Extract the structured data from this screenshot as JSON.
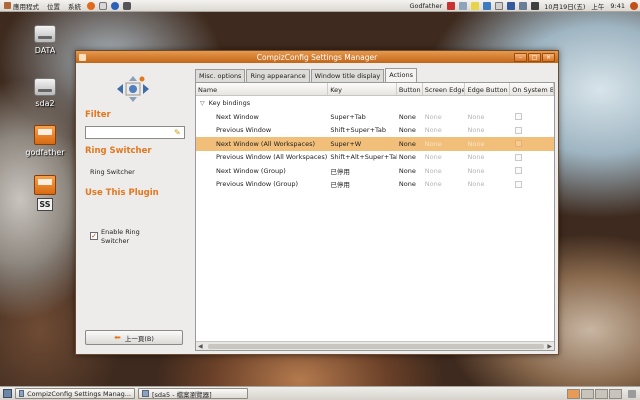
{
  "top_panel": {
    "menus": [
      "應用程式",
      "位置",
      "系統"
    ],
    "user": "Godfather",
    "date": "10月19日(五)",
    "ampm": "上午",
    "time": "9:41"
  },
  "desktop_icons": [
    {
      "label": "DATA",
      "icon": "drive-icon"
    },
    {
      "label": "sda2",
      "icon": "drive-icon"
    },
    {
      "label": "godfather",
      "icon": "folder-icon"
    },
    {
      "label": "SS",
      "icon": "folder-icon"
    }
  ],
  "window": {
    "title": "CompizConfig Settings Manager",
    "filter_heading": "Filter",
    "filter_value": "",
    "plugin_heading": "Ring Switcher",
    "plugin_name": "Ring Switcher",
    "use_heading": "Use This Plugin",
    "enable_label": "Enable Ring Switcher",
    "enable_checked": true,
    "back_label": "上一頁(B)",
    "tabs": [
      "Misc. options",
      "Ring appearance",
      "Window title display",
      "Actions"
    ],
    "active_tab": 3,
    "columns": [
      "Name",
      "Key",
      "Button",
      "Screen Edge",
      "Edge Button",
      "On System B"
    ],
    "group": "Key bindings",
    "rows": [
      {
        "name": "Next Window",
        "key": "Super+Tab",
        "button": "None",
        "edge": "None",
        "edge_button": "None"
      },
      {
        "name": "Previous Window",
        "key": "Shift+Super+Tab",
        "button": "None",
        "edge": "None",
        "edge_button": "None"
      },
      {
        "name": "Next Window (All Workspaces)",
        "key": "Super+W",
        "button": "None",
        "edge": "None",
        "edge_button": "None"
      },
      {
        "name": "Previous Window (All Workspaces)",
        "key": "Shift+Alt+Super+Tab",
        "button": "None",
        "edge": "None",
        "edge_button": "None"
      },
      {
        "name": "Next Window (Group)",
        "key": "已停用",
        "button": "None",
        "edge": "None",
        "edge_button": "None"
      },
      {
        "name": "Previous Window (Group)",
        "key": "已停用",
        "button": "None",
        "edge": "None",
        "edge_button": "None"
      }
    ],
    "selected_row": 2
  },
  "taskbar": {
    "tasks": [
      "CompizConfig Settings Manag...",
      "[sda5 - 檔案瀏覽器]"
    ],
    "workspaces": 4,
    "active_workspace": 0
  },
  "colors": {
    "accent": "#e2771f",
    "title_bar": "#d67424",
    "selection": "#f2bf7a"
  }
}
